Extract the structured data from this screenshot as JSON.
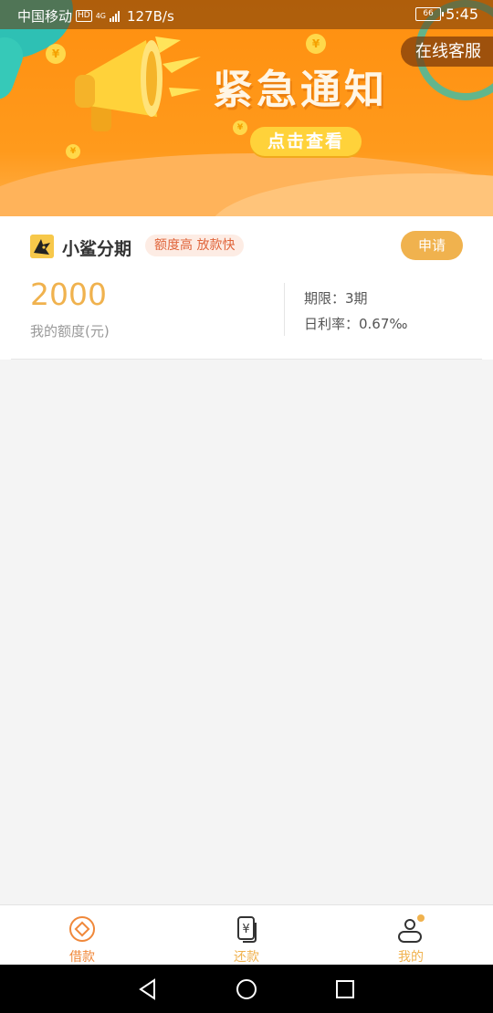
{
  "status_bar": {
    "carrier": "中国移动",
    "hd_badge": "HD",
    "network": "4G",
    "speed": "127B/s",
    "battery": "66",
    "time": "5:45"
  },
  "banner": {
    "title": "紧急通知",
    "button_label": "点击查看",
    "service_label": "在线客服",
    "coin_symbol": "¥"
  },
  "product": {
    "name": "小鲨分期",
    "tag": "额度高 放款快",
    "apply_label": "申请",
    "amount": "2000",
    "amount_label": "我的额度(元)",
    "term": "期限：3期",
    "rate": "日利率：0.67‰"
  },
  "tabbar": {
    "items": [
      {
        "label": "借款",
        "icon": "borrow-icon"
      },
      {
        "label": "还款",
        "icon": "repay-icon"
      },
      {
        "label": "我的",
        "icon": "profile-icon"
      }
    ]
  },
  "colors": {
    "accent": "#f0b24e",
    "active": "#f0883a",
    "banner": "#ff8f0f"
  }
}
